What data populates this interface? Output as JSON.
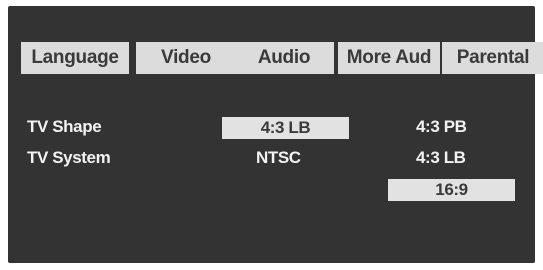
{
  "tabs": [
    {
      "label": "Language"
    },
    {
      "label": "Video"
    },
    {
      "label": "Audio"
    },
    {
      "label": "More Aud"
    },
    {
      "label": "Parental"
    }
  ],
  "settings": {
    "tv_shape": {
      "label": "TV Shape",
      "current_value": "4:3 LB",
      "options": [
        "4:3 PB",
        "4:3 LB",
        "16:9"
      ]
    },
    "tv_system": {
      "label": "TV System",
      "value": "NTSC"
    }
  },
  "colors": {
    "panel_background": "#333333",
    "tab_background": "#dcdcdc",
    "highlight_box": "#e2e2e2",
    "text_light": "#f2f2f2",
    "text_dark": "#3a3a3a"
  }
}
